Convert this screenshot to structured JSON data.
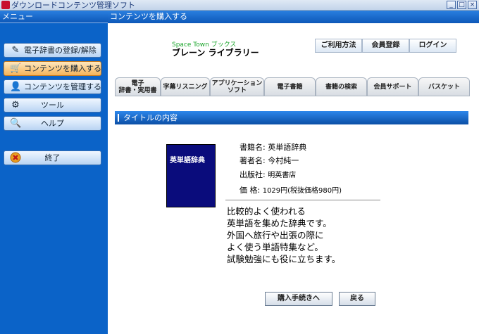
{
  "window": {
    "title": "ダウンロードコンテンツ管理ソフト"
  },
  "left_panel": {
    "header": "メニュー",
    "items": [
      {
        "label": "電子辞書の登録/解除",
        "icon": "✎"
      },
      {
        "label": "コンテンツを購入する",
        "icon": "🛒"
      },
      {
        "label": "コンテンツを管理する",
        "icon": "👤"
      },
      {
        "label": "ツール",
        "icon": "⚙"
      },
      {
        "label": "ヘルプ",
        "icon": "🔍"
      }
    ],
    "exit_label": "終了"
  },
  "right_panel": {
    "header": "コンテンツを購入する",
    "brand_sub": "Space Town ブックス",
    "brand_main": "ブレーン ライブラリー",
    "top_buttons": [
      "ご利用方法",
      "会員登録",
      "ログイン"
    ],
    "tabs": [
      {
        "line1": "電子",
        "line2": "辞書・実用書"
      },
      {
        "line1": "字幕リスニング",
        "line2": ""
      },
      {
        "line1": "アプリケーション",
        "line2": "ソフト"
      },
      {
        "line1": "電子書籍",
        "line2": ""
      },
      {
        "line1": "書籍の検索",
        "line2": ""
      },
      {
        "line1": "会員サポート",
        "line2": ""
      },
      {
        "line1": "バスケット",
        "line2": ""
      }
    ],
    "section_title": "タイトルの内容"
  },
  "book": {
    "cover_title": "英単語辞典",
    "title_label": "書籍名:",
    "title_value": "英単語辞典",
    "author_label": "著者名:",
    "author_value": "今村純一",
    "publisher_label": "出版社:",
    "publisher_value": "明英書店",
    "price_label": "価 格:",
    "price_value": "1029円(税抜価格980円)",
    "description": [
      "比較的よく使われる",
      "英単語を集めた辞典です。",
      "外国へ旅行や出張の際に",
      "よく使う単語特集など。",
      "試験勉強にも役に立ちます。"
    ]
  },
  "actions": {
    "purchase_label": "購入手続きへ",
    "back_label": "戻る"
  }
}
